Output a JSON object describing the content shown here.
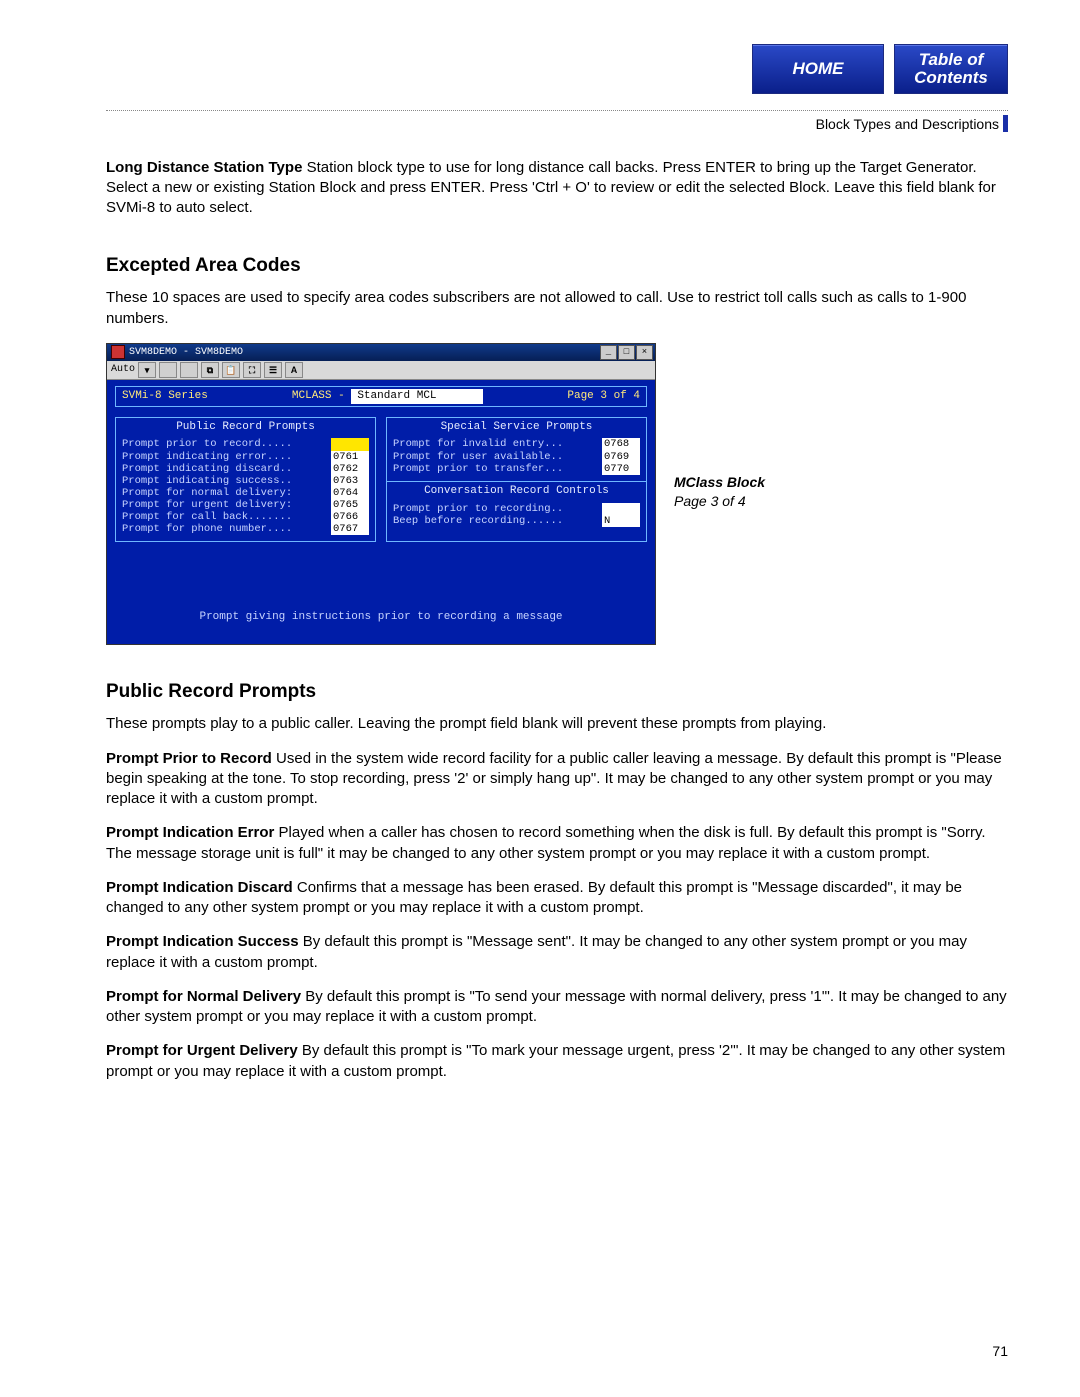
{
  "nav": {
    "home": "HOME",
    "toc_line1": "Table of",
    "toc_line2": "Contents"
  },
  "breadcrumb": "Block Types and Descriptions",
  "intro": {
    "term": "Long Distance Station Type",
    "text": "   Station block type to use for long distance call backs.  Press ENTER to bring up the Target Generator. Select a new or existing Station Block and press ENTER.  Press 'Ctrl + O'  to review or edit the selected Block. Leave this field blank for SVMi-8 to auto select."
  },
  "sec1": {
    "title": "Excepted Area Codes",
    "text": "These 10 spaces are used to specify area codes subscribers are not allowed to call.  Use to restrict toll calls such as calls to 1-900 numbers."
  },
  "window": {
    "title": "SVM8DEMO - SVM8DEMO",
    "toolbar_label": "Auto",
    "header": {
      "left": "SVMi-8 Series",
      "mid_label": "MCLASS - ",
      "mid_value": "Standard MCL",
      "right": "Page 3 of 4"
    },
    "left_panel": {
      "title": "Public Record Prompts",
      "rows": [
        {
          "label": "Prompt prior to record.....",
          "value": "",
          "hot": true
        },
        {
          "label": "Prompt indicating error....",
          "value": "0761"
        },
        {
          "label": "Prompt indicating discard..",
          "value": "0762"
        },
        {
          "label": "Prompt indicating success..",
          "value": "0763"
        },
        {
          "label": "Prompt for normal delivery:",
          "value": "0764"
        },
        {
          "label": "Prompt for urgent delivery:",
          "value": "0765"
        },
        {
          "label": "Prompt for call back.......",
          "value": "0766"
        },
        {
          "label": "Prompt for phone number....",
          "value": "0767"
        }
      ]
    },
    "right_panel": {
      "title": "Special Service Prompts",
      "rows": [
        {
          "label": "Prompt for invalid entry...",
          "value": "0768"
        },
        {
          "label": "Prompt for user available..",
          "value": "0769"
        },
        {
          "label": "Prompt prior to transfer...",
          "value": "0770"
        }
      ],
      "sub_title": "Conversation Record Controls",
      "sub_rows": [
        {
          "label": "Prompt prior to recording..",
          "value": ""
        },
        {
          "label": "Beep before recording......",
          "value": "N"
        }
      ]
    },
    "status": "Prompt giving instructions prior to recording a message"
  },
  "caption": {
    "line1": "MClass Block",
    "line2": "Page 3 of 4"
  },
  "sec2": {
    "title": "Public Record Prompts",
    "lead": "These prompts play to a public caller. Leaving the prompt field blank will prevent these prompts from playing.",
    "items": [
      {
        "term": "Prompt Prior to Record",
        "text": "   Used in the system wide record facility for a public caller leaving a message. By default this prompt is \"Please begin speaking at the tone. To stop recording, press '2' or simply hang up\". It may be changed to any other system prompt or you may replace it with a custom prompt."
      },
      {
        "term": "Prompt Indication Error",
        "text": "   Played when a caller has chosen to record something when the disk is full. By default this prompt is \"Sorry. The message storage unit is full\" it may be changed to any other system prompt or you may replace it with a custom prompt."
      },
      {
        "term": "Prompt Indication Discard",
        "text": "   Confirms that a message has been erased. By default this prompt is \"Message discarded\", it may be changed to any other system prompt or you may replace it with a custom prompt."
      },
      {
        "term": "Prompt Indication Success",
        "text": "   By default this prompt is \"Message sent\". It may be changed to any other system prompt or you may replace it with a custom prompt."
      },
      {
        "term": "Prompt for Normal Delivery",
        "text": "   By default this prompt is \"To send your message with normal delivery, press '1'\". It may be changed to any other system prompt or you may replace it with a custom prompt."
      },
      {
        "term": "Prompt for Urgent Delivery",
        "text": "   By default this prompt is \"To mark your message urgent, press '2'\". It may be changed to any other system prompt or you may replace it with a custom prompt."
      }
    ]
  },
  "page_number": "71"
}
